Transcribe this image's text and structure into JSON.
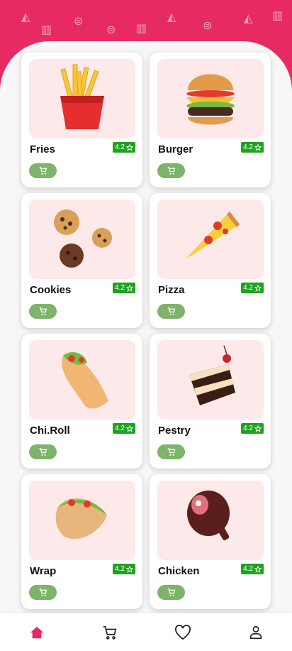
{
  "colors": {
    "brand": "#e82a63",
    "rating": "#1fa31f",
    "cart": "#7db36a",
    "tile": "#fde9e9"
  },
  "products": [
    {
      "name": "Fries",
      "rating": "4.2",
      "icon": "fries-image"
    },
    {
      "name": "Burger",
      "rating": "4.2",
      "icon": "burger-image"
    },
    {
      "name": "Cookies",
      "rating": "4.2",
      "icon": "cookies-image"
    },
    {
      "name": "Pizza",
      "rating": "4.2",
      "icon": "pizza-image"
    },
    {
      "name": "Chi.Roll",
      "rating": "4.2",
      "icon": "roll-image"
    },
    {
      "name": "Pestry",
      "rating": "4.2",
      "icon": "cake-image"
    },
    {
      "name": "Wrap",
      "rating": "4.2",
      "icon": "wrap-image"
    },
    {
      "name": "Chicken",
      "rating": "4.2",
      "icon": "chicken-image"
    }
  ],
  "nav": [
    {
      "icon": "home-icon",
      "active": true
    },
    {
      "icon": "cart-icon",
      "active": false
    },
    {
      "icon": "heart-icon",
      "active": false
    },
    {
      "icon": "user-icon",
      "active": false
    }
  ]
}
